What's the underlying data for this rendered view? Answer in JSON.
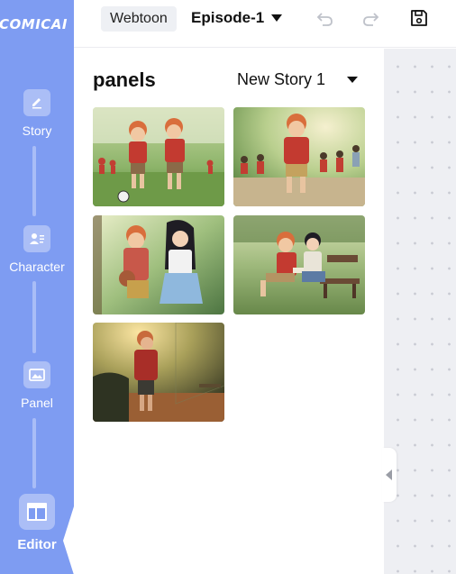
{
  "app": {
    "logo_text": "COMICAI"
  },
  "sidebar": {
    "items": [
      {
        "label": "Story",
        "icon": "pencil-icon"
      },
      {
        "label": "Character",
        "icon": "person-card-icon"
      },
      {
        "label": "Panel",
        "icon": "image-icon"
      },
      {
        "label": "Editor",
        "icon": "layout-icon",
        "active": true
      }
    ]
  },
  "topbar": {
    "format_label": "Webtoon",
    "episode_label": "Episode-1",
    "icons": [
      "undo-icon",
      "redo-icon",
      "save-icon"
    ]
  },
  "panels": {
    "title": "panels",
    "story_selected": "New Story 1",
    "thumbnails": [
      {
        "name": "panel-thumb-1",
        "scene": "boys-running-soccer-field"
      },
      {
        "name": "panel-thumb-2",
        "scene": "boy-running-with-group"
      },
      {
        "name": "panel-thumb-3",
        "scene": "boy-with-ball-and-girl"
      },
      {
        "name": "panel-thumb-4",
        "scene": "pair-reading-on-bench"
      },
      {
        "name": "panel-thumb-5",
        "scene": "boy-at-fence-sunset"
      }
    ]
  },
  "colors": {
    "sidebar": "#7e9cf2",
    "canvas": "#eeeff3"
  }
}
